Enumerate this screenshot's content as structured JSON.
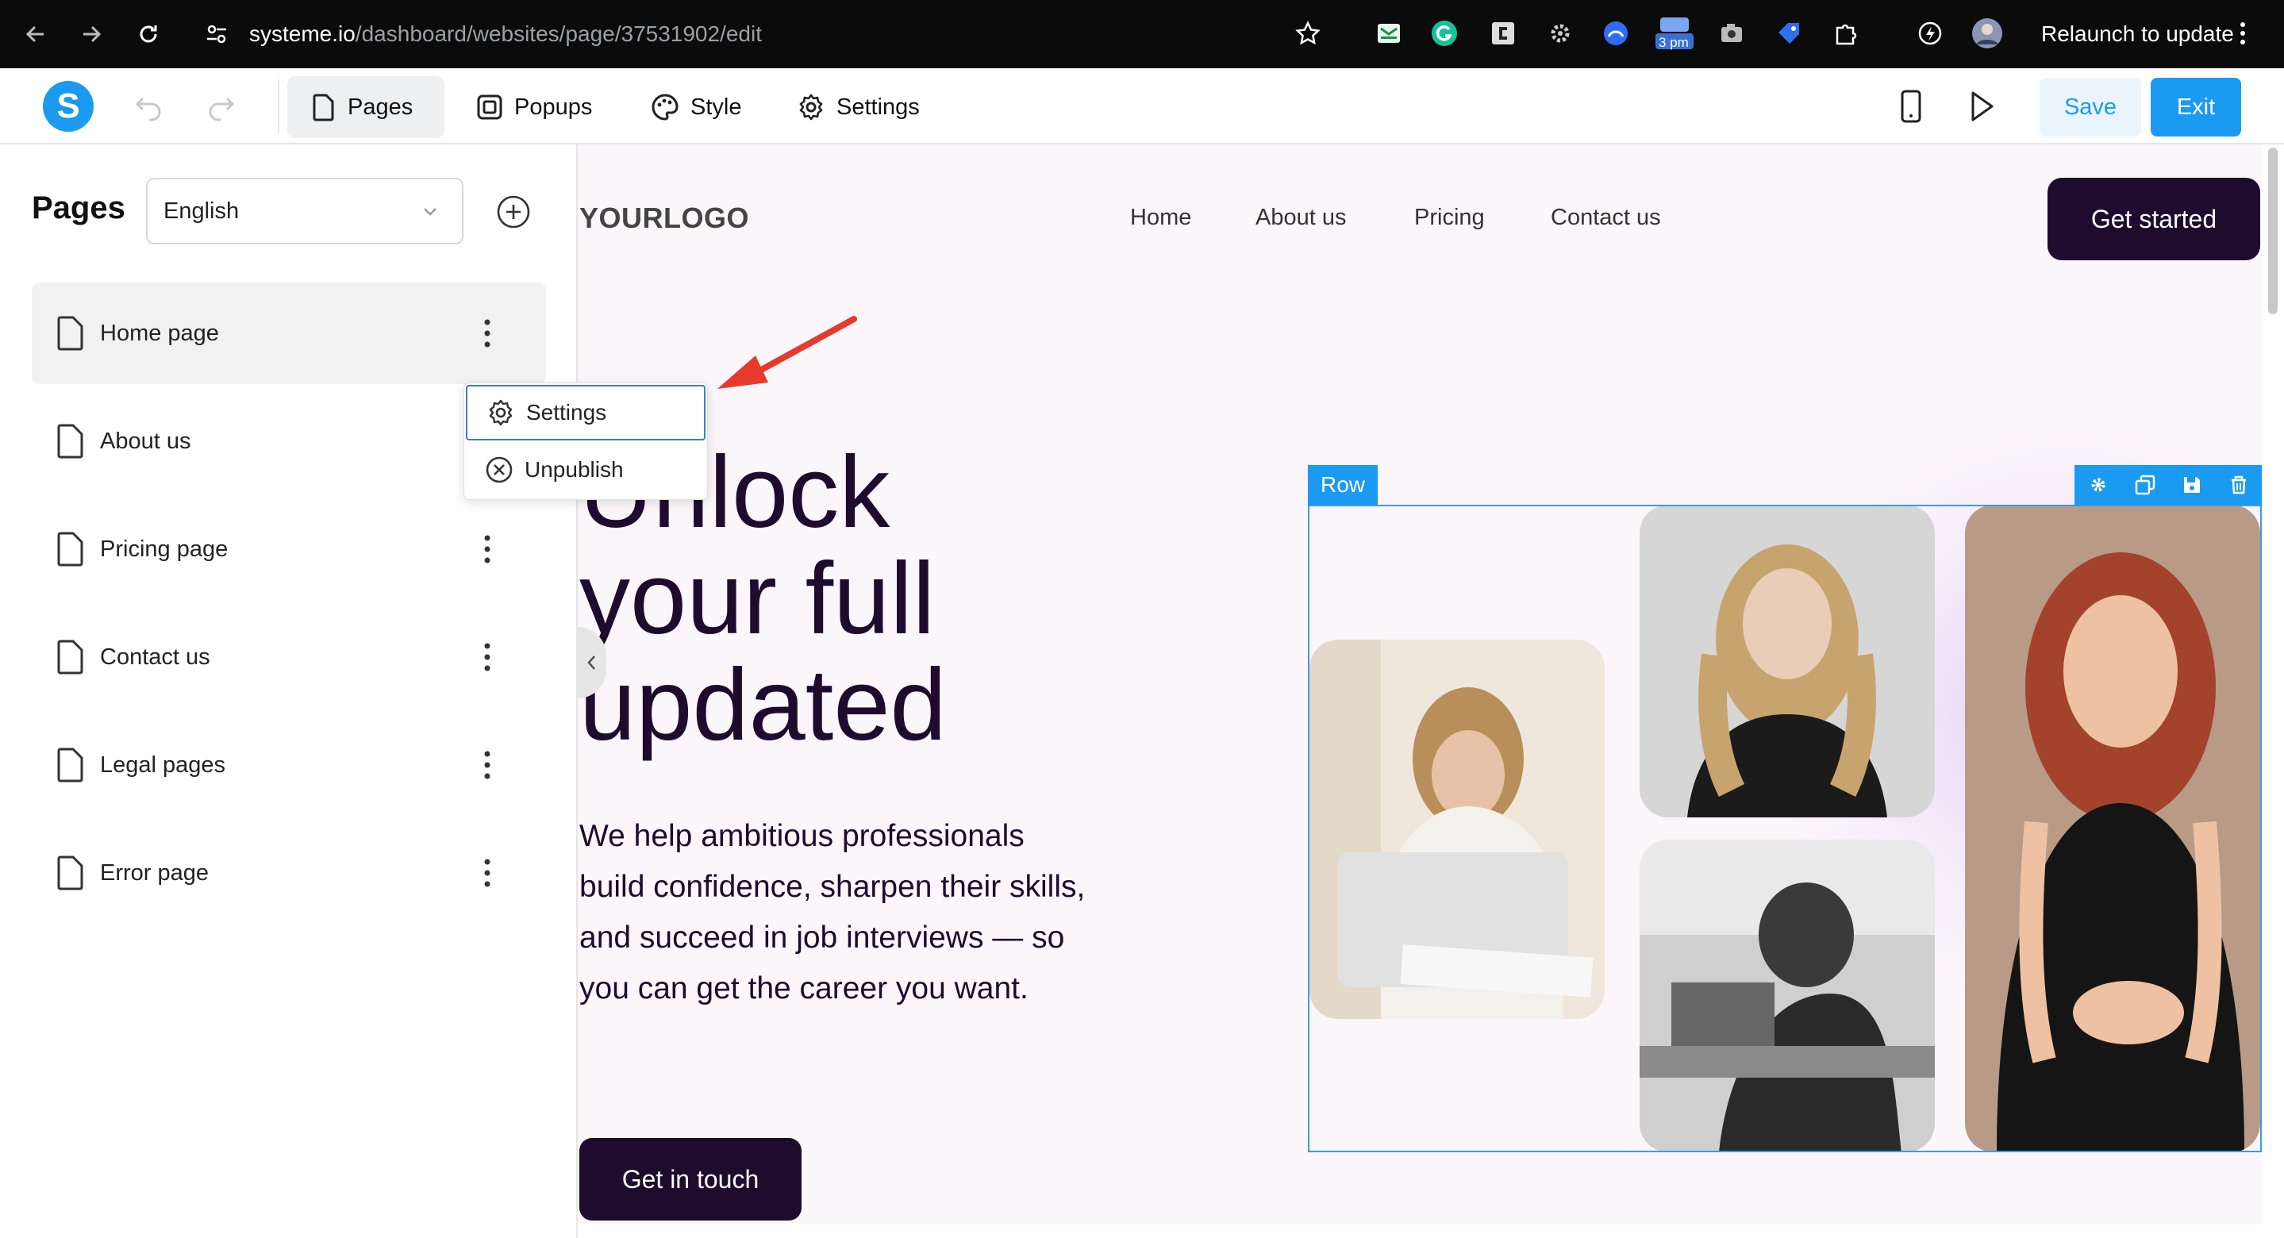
{
  "browser": {
    "url_host": "systeme.io",
    "url_path": "/dashboard/websites/page/37531902/edit",
    "relaunch_label": "Relaunch to update",
    "extension_badge": "3 pm"
  },
  "toolbar": {
    "tabs": [
      {
        "label": "Pages",
        "icon": "page-icon"
      },
      {
        "label": "Popups",
        "icon": "popup-icon"
      },
      {
        "label": "Style",
        "icon": "palette-icon"
      },
      {
        "label": "Settings",
        "icon": "gear-icon"
      }
    ],
    "save_label": "Save",
    "exit_label": "Exit"
  },
  "sidebar": {
    "title": "Pages",
    "language": "English",
    "pages": [
      {
        "label": "Home page"
      },
      {
        "label": "About us"
      },
      {
        "label": "Pricing page"
      },
      {
        "label": "Contact us"
      },
      {
        "label": "Legal pages"
      },
      {
        "label": "Error page"
      }
    ]
  },
  "context_menu": {
    "items": [
      {
        "label": "Settings",
        "icon": "gear-icon"
      },
      {
        "label": "Unpublish",
        "icon": "x-circle-icon"
      }
    ]
  },
  "site": {
    "logo": "YOURLOGO",
    "nav": [
      "Home",
      "About us",
      "Pricing",
      "Contact us"
    ],
    "cta_top": "Get started",
    "headline": "Unlock\nyour full\nupdated",
    "subtext": "We help ambitious professionals build confidence, sharpen their skills, and succeed in job interviews — so you can get the career you want.",
    "cta_bottom": "Get in touch",
    "row_label": "Row"
  },
  "colors": {
    "accent": "#1a9af0",
    "dark_button": "#1f0b2e",
    "canvas_bg": "#fbf6fa",
    "annotation_arrow": "#e8392d"
  }
}
